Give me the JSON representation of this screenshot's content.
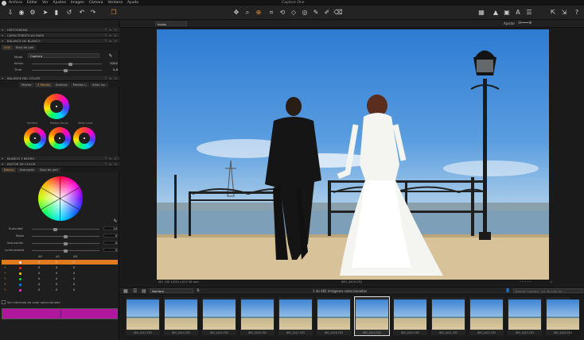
{
  "app": {
    "title": "Capture One"
  },
  "menu": [
    "Archivo",
    "Editar",
    "Ver",
    "Ajustes",
    "Imagen",
    "Cámara",
    "Ventana",
    "Ayuda"
  ],
  "toolbar": {
    "left_icons": [
      "import-icon",
      "camera-icon",
      "process-icon",
      "cursor-icon",
      "reset-icon",
      "undo-icon",
      "redo-icon",
      "copy-icon"
    ],
    "center_icons": [
      "pan-icon",
      "loupe-icon",
      "zoom-icon",
      "crop-icon",
      "rotate-icon",
      "keystone-icon",
      "spot-icon",
      "picker-icon",
      "brush-icon",
      "eraser-icon"
    ],
    "right_icons": [
      "grid-icon",
      "exposure-warning-icon",
      "proof-icon",
      "text-overlay-icon",
      "focus-mask-icon",
      "copy-adjust-icon",
      "apply-adjust-icon",
      "help-icon"
    ]
  },
  "viewer": {
    "background_label": "fondo",
    "adjust_label": "Ajustar",
    "info_left": "ISO 100  1/200 s  f/10  56 mm",
    "info_center": "IMG_4419.CR2"
  },
  "left_panel": {
    "sections": {
      "histogram": "HISTOGRAMA",
      "base": "CARACTERÍSTICAS BASE",
      "wb": "BALANCE DE BLANCO",
      "color_balance": "BALANCE DEL COLOR",
      "bw": "BLANCO Y NEGRO",
      "color_editor": "EDITOR DE COLOR"
    },
    "wb_tabs": [
      "Gris",
      "Tono de piel"
    ],
    "wb": {
      "mode_label": "Modo",
      "mode_value": "Captura",
      "kelvin_label": "Kelvin",
      "kelvin_value": "5202",
      "tint_label": "Tinte",
      "tint_value": "0,8"
    },
    "cb_tabs": [
      "Máster",
      "3 Modos",
      "Sombra",
      "Medios t.",
      "Altas luc."
    ],
    "wheels": [
      "Sombra",
      "Medios tonos",
      "Altas luces"
    ],
    "ce_tabs": [
      "Básico",
      "Avanzado",
      "Tono de piel"
    ],
    "sliders": [
      {
        "label": "Suavidad",
        "value": "10"
      },
      {
        "label": "Matiz",
        "value": "0"
      },
      {
        "label": "Saturación",
        "value": "0"
      },
      {
        "label": "Luminosidad",
        "value": "0"
      }
    ],
    "table_headers": [
      "ΔH",
      "ΔS",
      "ΔB"
    ],
    "table_rows": [
      {
        "color": "#e9e9e9",
        "h": "0",
        "s": "0",
        "b": "0"
      },
      {
        "color": "#ff2222",
        "h": "0",
        "s": "0",
        "b": "0"
      },
      {
        "color": "#ffd400",
        "h": "0",
        "s": "0",
        "b": "0"
      },
      {
        "color": "#11dd44",
        "h": "0",
        "s": "0",
        "b": "0"
      },
      {
        "color": "#0088ff",
        "h": "0",
        "s": "0",
        "b": "0"
      },
      {
        "color": "#ff33cc",
        "h": "0",
        "s": "0",
        "b": "0"
      }
    ],
    "range_checkbox_label": "Ver intervalo de color seleccionado",
    "accent_color": "#e07a1f",
    "selected_color": "#b0179d"
  },
  "browser": {
    "sort_label": "Nombre",
    "count_label": "1 de 481 Imágenes seleccionadas",
    "search_placeholder": "Buscar nombre · 22 de julio de..."
  },
  "thumbnails": [
    {
      "name": "IMG_4413.CR2"
    },
    {
      "name": "IMG_4414.CR2"
    },
    {
      "name": "IMG_4415.CR2"
    },
    {
      "name": "IMG_4416.CR2"
    },
    {
      "name": "IMG_4417.CR2"
    },
    {
      "name": "IMG_4418.CR2"
    },
    {
      "name": "IMG_4419.CR2",
      "selected": true
    },
    {
      "name": "IMG_4420.CR2"
    },
    {
      "name": "IMG_4421.CR2"
    },
    {
      "name": "IMG_4422.CR2"
    },
    {
      "name": "IMG_4423.CR2"
    },
    {
      "name": "IMG_4424.CR2"
    }
  ]
}
